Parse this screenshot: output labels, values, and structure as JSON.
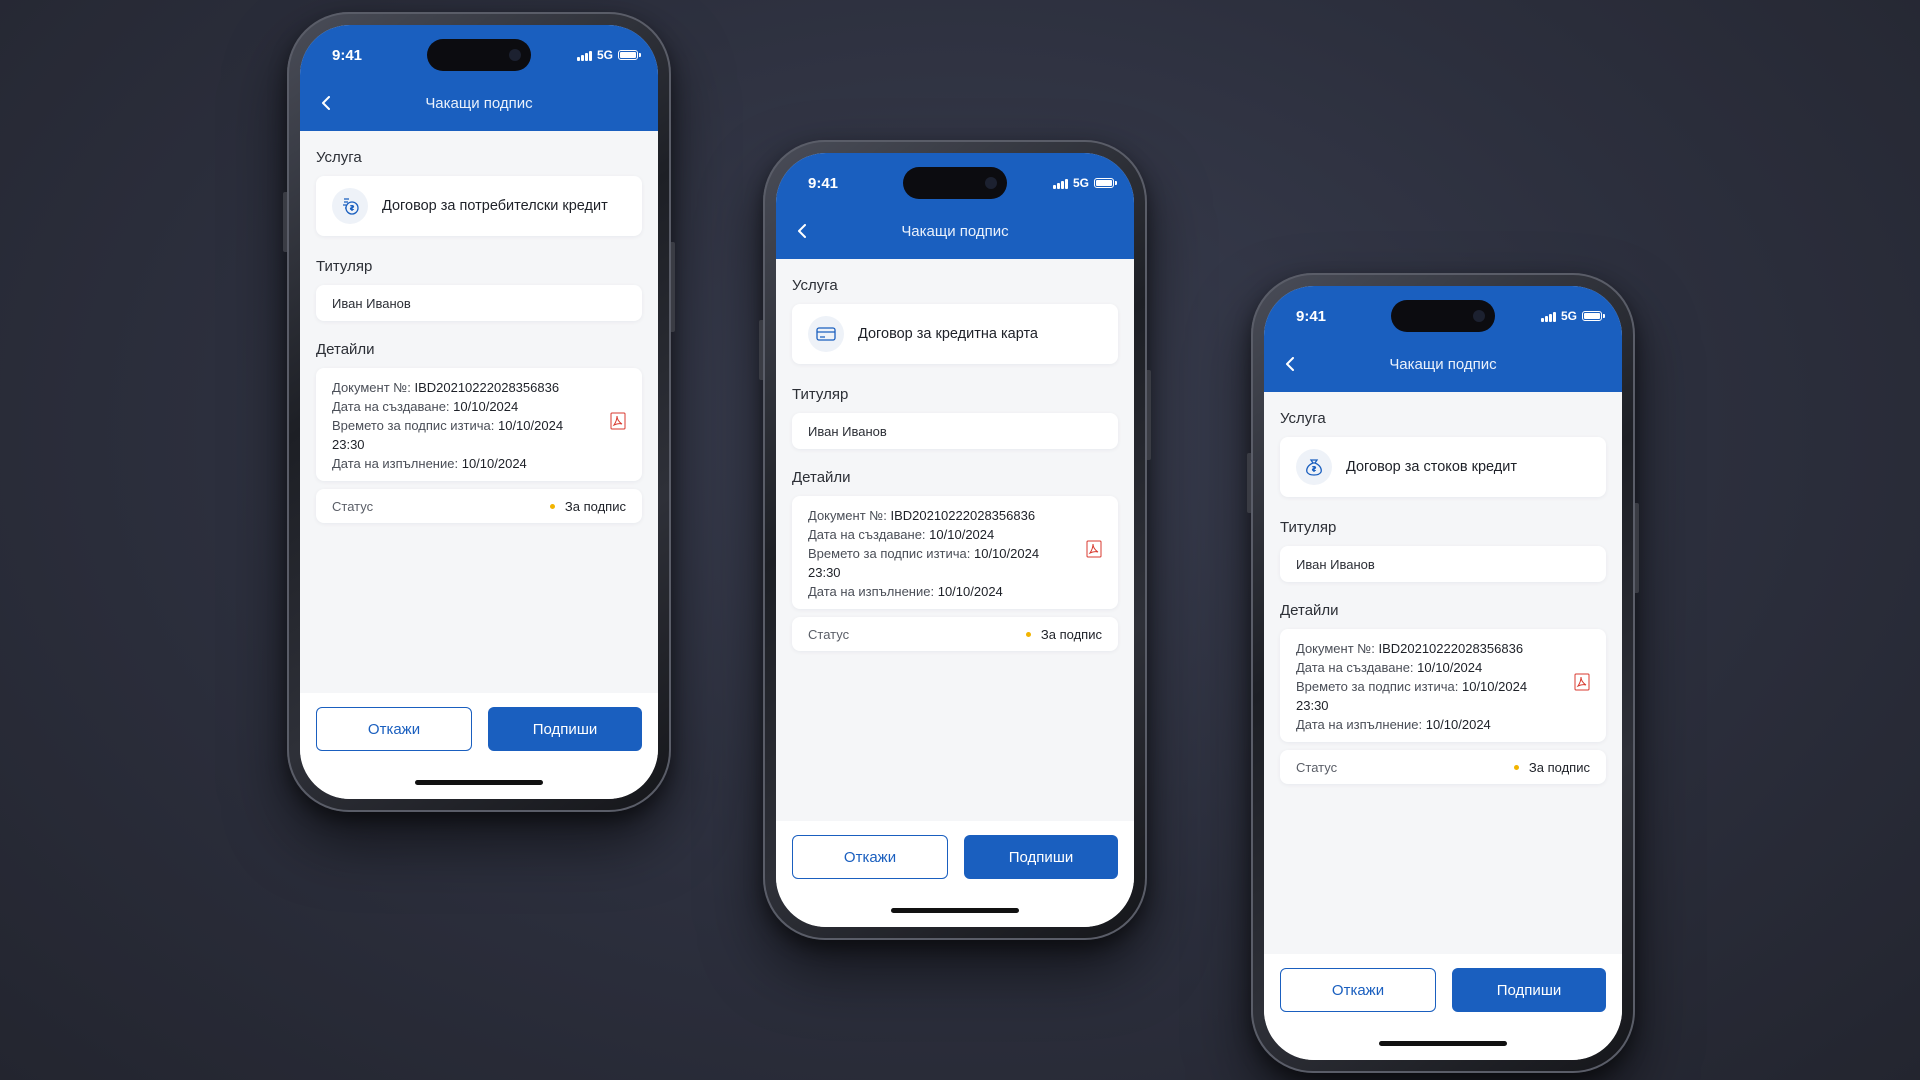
{
  "colors": {
    "brand_blue": "#1a5fbf",
    "status_pending": "#f2b400",
    "background": "#2c2f3d"
  },
  "phones": [
    {
      "status_time": "9:41",
      "network": "5G",
      "nav_title": "Чакащи подпис",
      "service_label": "Услуга",
      "service_icon": "coins-icon",
      "service_name": "Договор за потребителски кредит",
      "holder_label": "Титуляр",
      "holder_name": "Иван Иванов",
      "details_label": "Детайли",
      "doc_no_label": "Документ №:",
      "doc_no": "IBD20210222028356836",
      "created_label": "Дата на създаване:",
      "created": "10/10/2024",
      "expires_label": "Времето за подпис изтича:",
      "expires": "10/10/2024",
      "expires_time": "23:30",
      "exec_label": "Дата на изпълнение:",
      "exec": "10/10/2024",
      "status_label": "Статус",
      "status_value": "За подпис",
      "cancel_label": "Откажи",
      "sign_label": "Подпиши"
    },
    {
      "status_time": "9:41",
      "network": "5G",
      "nav_title": "Чакащи подпис",
      "service_label": "Услуга",
      "service_icon": "credit-card-icon",
      "service_name": "Договор за кредитна карта",
      "holder_label": "Титуляр",
      "holder_name": "Иван Иванов",
      "details_label": "Детайли",
      "doc_no_label": "Документ №:",
      "doc_no": "IBD20210222028356836",
      "created_label": "Дата на създаване:",
      "created": "10/10/2024",
      "expires_label": "Времето за подпис изтича:",
      "expires": "10/10/2024",
      "expires_time": "23:30",
      "exec_label": "Дата на изпълнение:",
      "exec": "10/10/2024",
      "status_label": "Статус",
      "status_value": "За подпис",
      "cancel_label": "Откажи",
      "sign_label": "Подпиши"
    },
    {
      "status_time": "9:41",
      "network": "5G",
      "nav_title": "Чакащи подпис",
      "service_label": "Услуга",
      "service_icon": "money-bag-icon",
      "service_name": "Договор за стоков кредит",
      "holder_label": "Титуляр",
      "holder_name": "Иван Иванов",
      "details_label": "Детайли",
      "doc_no_label": "Документ №:",
      "doc_no": "IBD20210222028356836",
      "created_label": "Дата на създаване:",
      "created": "10/10/2024",
      "expires_label": "Времето за подпис изтича:",
      "expires": "10/10/2024",
      "expires_time": "23:30",
      "exec_label": "Дата на изпълнение:",
      "exec": "10/10/2024",
      "status_label": "Статус",
      "status_value": "За подпис",
      "cancel_label": "Откажи",
      "sign_label": "Подпиши"
    }
  ]
}
